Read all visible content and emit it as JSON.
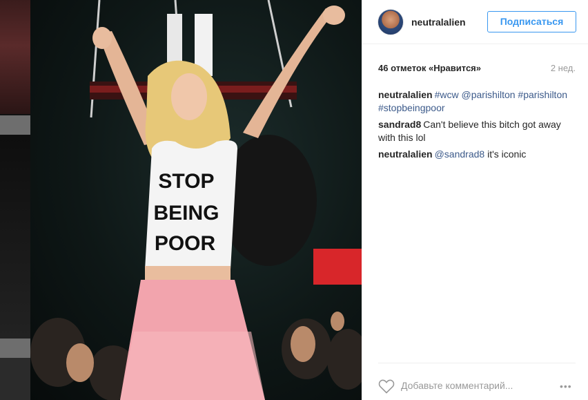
{
  "post": {
    "username": "neutralalien",
    "follow_label": "Подписаться",
    "likes": "46 отметок «Нравится»",
    "time_ago": "2 нед.",
    "shirt_text": [
      "STOP",
      "BEING",
      "POOR"
    ]
  },
  "comments": [
    {
      "user": "neutralalien",
      "parts": [
        {
          "kind": "tag",
          "text": "#wcw"
        },
        {
          "kind": "txt",
          "text": " "
        },
        {
          "kind": "tag",
          "text": "@parishilton"
        },
        {
          "kind": "txt",
          "text": " "
        },
        {
          "kind": "tag",
          "text": "#parishilton"
        },
        {
          "kind": "txt",
          "text": " "
        },
        {
          "kind": "tag",
          "text": "#stopbeingpoor"
        }
      ]
    },
    {
      "user": "sandrad8",
      "parts": [
        {
          "kind": "txt",
          "text": "Can't believe this bitch got away with this lol"
        }
      ]
    },
    {
      "user": "neutralalien",
      "parts": [
        {
          "kind": "tag",
          "text": "@sandrad8"
        },
        {
          "kind": "txt",
          "text": " it's iconic"
        }
      ]
    }
  ],
  "footer": {
    "add_comment_placeholder": "Добавьте комментарий...",
    "more_label": "•••"
  },
  "icons": {
    "heart": "heart-icon",
    "more": "ellipsis-icon"
  },
  "colors": {
    "accent": "#3897f0",
    "hashtag": "#3c5a8a",
    "muted": "#999999"
  }
}
